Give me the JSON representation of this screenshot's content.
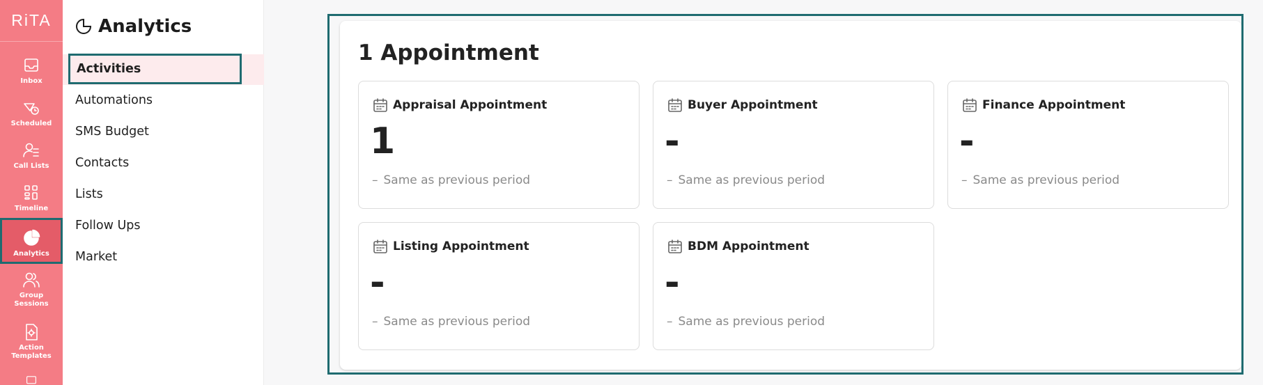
{
  "rail": {
    "logo": "RiTA",
    "items": [
      {
        "label": "Inbox",
        "icon": "inbox-icon"
      },
      {
        "label": "Scheduled",
        "icon": "scheduled-icon"
      },
      {
        "label": "Call Lists",
        "icon": "call-lists-icon"
      },
      {
        "label": "Timeline",
        "icon": "timeline-icon"
      },
      {
        "label": "Analytics",
        "icon": "pie-chart-icon",
        "active": true
      },
      {
        "label": "Group Sessions",
        "icon": "group-sessions-icon"
      },
      {
        "label": "Action Templates",
        "icon": "action-templates-icon"
      }
    ]
  },
  "subnav": {
    "title": "Analytics",
    "items": [
      {
        "label": "Activities",
        "active": true
      },
      {
        "label": "Automations"
      },
      {
        "label": "SMS Budget"
      },
      {
        "label": "Contacts"
      },
      {
        "label": "Lists"
      },
      {
        "label": "Follow Ups"
      },
      {
        "label": "Market"
      }
    ]
  },
  "main": {
    "title": "1 Appointment",
    "tiles": [
      {
        "label": "Appraisal Appointment",
        "value": "1",
        "change": "Same as previous period"
      },
      {
        "label": "Buyer Appointment",
        "value": "-",
        "change": "Same as previous period"
      },
      {
        "label": "Finance Appointment",
        "value": "-",
        "change": "Same as previous period"
      },
      {
        "label": "Listing Appointment",
        "value": "-",
        "change": "Same as previous period"
      },
      {
        "label": "BDM Appointment",
        "value": "-",
        "change": "Same as previous period"
      }
    ],
    "change_symbol": "–"
  },
  "colors": {
    "rail_bg": "#f47c85",
    "rail_active_bg": "#e45c68",
    "highlight_outline": "#1f6b70",
    "subnav_active_bg": "#fdebed"
  }
}
